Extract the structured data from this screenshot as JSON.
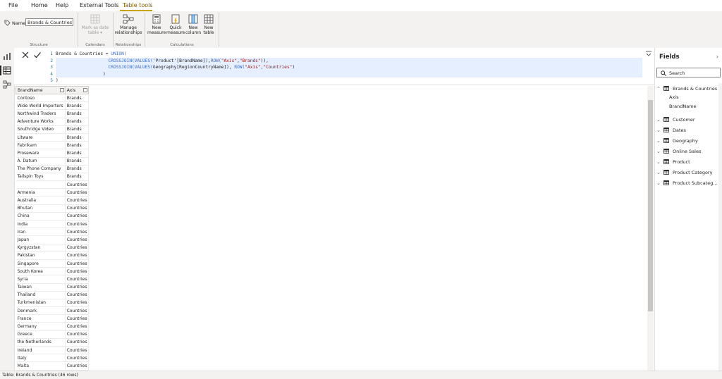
{
  "menu": {
    "tabs": [
      "File",
      "Home",
      "Help",
      "External Tools",
      "Table tools"
    ],
    "active_tab": "Table tools"
  },
  "ribbon": {
    "name_label": "Name",
    "name_value": "Brands & Countries",
    "groups": {
      "structure": "Structure",
      "calendars": "Calendars",
      "relationships": "Relationships",
      "calculations": "Calculations"
    },
    "buttons": {
      "mark_date_line1": "Mark as date",
      "mark_date_line2": "table ▾",
      "manage_rel_line1": "Manage",
      "manage_rel_line2": "relationships",
      "new_measure_line1": "New",
      "new_measure_line2": "measure",
      "quick_measure_line1": "Quick",
      "quick_measure_line2": "measure",
      "new_column_line1": "New",
      "new_column_line2": "column",
      "new_table_line1": "New",
      "new_table_line2": "table"
    }
  },
  "formula": {
    "line_numbers": [
      "1",
      "2",
      "3",
      "4",
      "5"
    ],
    "l1_name": "Brands & Countries = ",
    "l1_fn": "UNION(",
    "l2_indent": "                    ",
    "l2_fn1": "CROSSJOIN(VALUES(",
    "l2_mid": "'Product'[BrandName]),",
    "l2_fn2": "ROW(",
    "l2_s1": "\"Axis\"",
    "l2_comma": ",",
    "l2_s2": "\"Brands\"",
    "l2_end": ")),",
    "l3_indent": "                    ",
    "l3_fn1": "CROSSJOIN(VALUES(",
    "l3_mid": "Geography[RegionCountryName]), ",
    "l3_fn2": "ROW(",
    "l3_s1": "\"Axis\"",
    "l3_comma": ",",
    "l3_s2": "\"Countries\"",
    "l3_end": ")",
    "l4": "                  )",
    "l5": ")"
  },
  "table": {
    "columns": [
      "BrandName",
      "Axis"
    ],
    "rows": [
      [
        "Contoso",
        "Brands"
      ],
      [
        "Wide World Importers",
        "Brands"
      ],
      [
        "Northwind Traders",
        "Brands"
      ],
      [
        "Adventure Works",
        "Brands"
      ],
      [
        "Southridge Video",
        "Brands"
      ],
      [
        "Litware",
        "Brands"
      ],
      [
        "Fabrikam",
        "Brands"
      ],
      [
        "Proseware",
        "Brands"
      ],
      [
        "A. Datum",
        "Brands"
      ],
      [
        "The Phone Company",
        "Brands"
      ],
      [
        "Tailspin Toys",
        "Brands"
      ],
      [
        "",
        "Countries"
      ],
      [
        "Armenia",
        "Countries"
      ],
      [
        "Australia",
        "Countries"
      ],
      [
        "Bhutan",
        "Countries"
      ],
      [
        "China",
        "Countries"
      ],
      [
        "India",
        "Countries"
      ],
      [
        "Iran",
        "Countries"
      ],
      [
        "Japan",
        "Countries"
      ],
      [
        "Kyrgyzstan",
        "Countries"
      ],
      [
        "Pakistan",
        "Countries"
      ],
      [
        "Singapore",
        "Countries"
      ],
      [
        "South Korea",
        "Countries"
      ],
      [
        "Syria",
        "Countries"
      ],
      [
        "Taiwan",
        "Countries"
      ],
      [
        "Thailand",
        "Countries"
      ],
      [
        "Turkmenistan",
        "Countries"
      ],
      [
        "Denmark",
        "Countries"
      ],
      [
        "France",
        "Countries"
      ],
      [
        "Germany",
        "Countries"
      ],
      [
        "Greece",
        "Countries"
      ],
      [
        "the Netherlands",
        "Countries"
      ],
      [
        "Ireland",
        "Countries"
      ],
      [
        "Italy",
        "Countries"
      ],
      [
        "Malta",
        "Countries"
      ]
    ]
  },
  "fields": {
    "title": "Fields",
    "search_placeholder": "Search",
    "tables": [
      {
        "name": "Brands & Countries",
        "expanded": true,
        "children": [
          "Axis",
          "BrandName"
        ]
      },
      {
        "name": "Customer",
        "expanded": false
      },
      {
        "name": "Dates",
        "expanded": false
      },
      {
        "name": "Geography",
        "expanded": false
      },
      {
        "name": "Online Sales",
        "expanded": false
      },
      {
        "name": "Product",
        "expanded": false
      },
      {
        "name": "Product Category",
        "expanded": false
      },
      {
        "name": "Product Subcateg...",
        "expanded": false
      }
    ]
  },
  "status": {
    "text": "Table: Brands & Countries (46 rows)"
  },
  "colors": {
    "accent": "#c8a300",
    "keyword": "#3b6fd1",
    "string": "#a31515"
  }
}
